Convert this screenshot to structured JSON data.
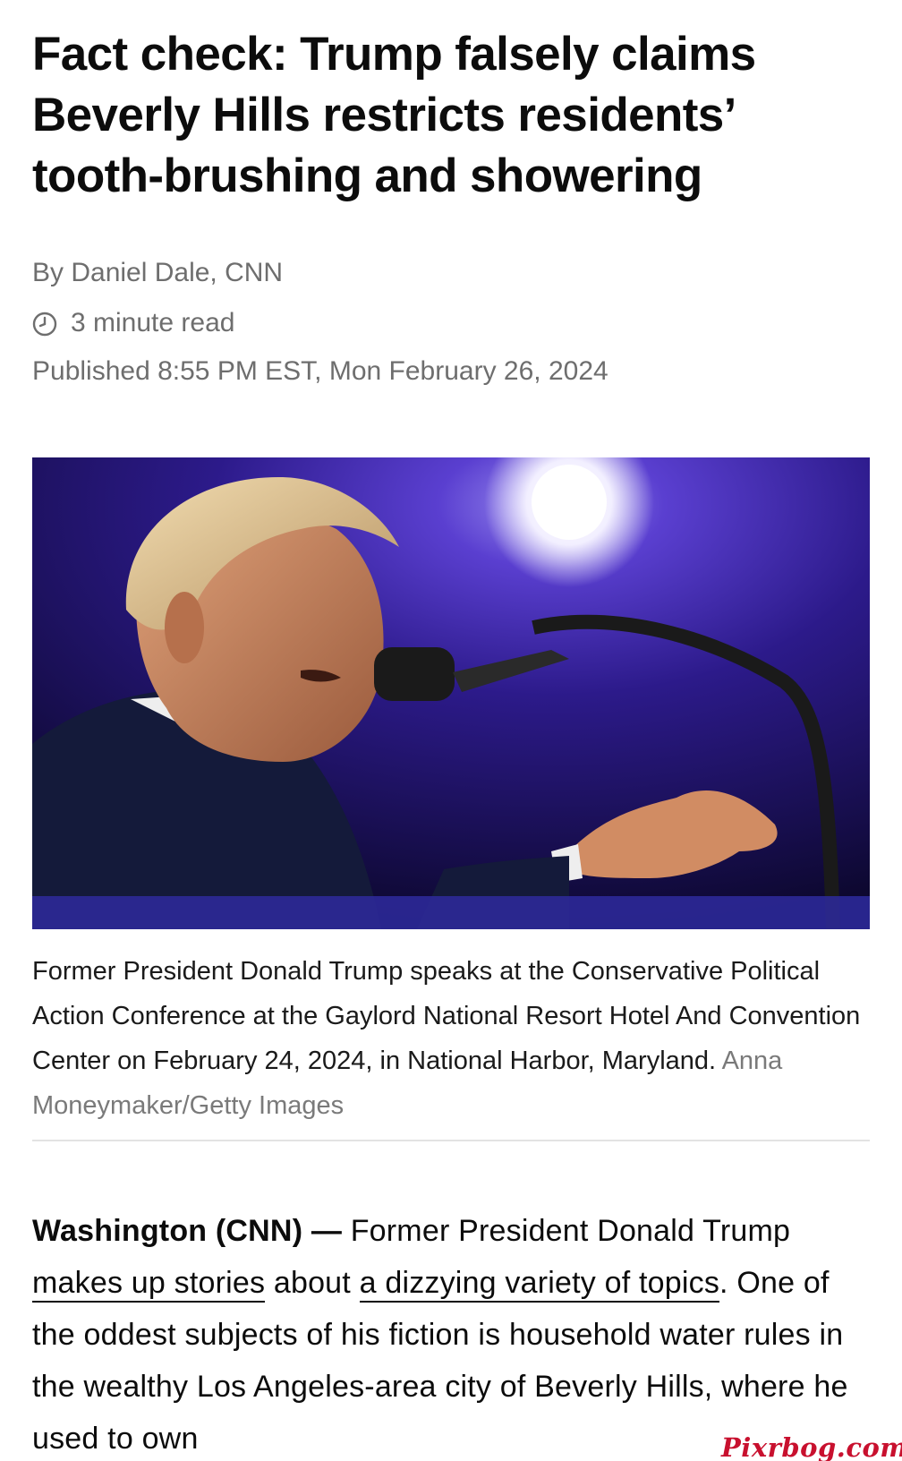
{
  "article": {
    "headline": "Fact check: Trump falsely claims Beverly Hills restricts residents’ tooth-brushing and showering",
    "byline": "By Daniel Dale, CNN",
    "read_time": "3 minute read",
    "published": "Published 8:55 PM EST, Mon February 26, 2024",
    "read_time_icon": "clock-icon"
  },
  "photo": {
    "caption": "Former President Donald Trump speaks at the Conservative Political Action Conference at the Gaylord National Resort Hotel And Convention Center on February 24, 2024, in National Harbor, Maryland.",
    "credit": "Anna Moneymaker/Getty Images"
  },
  "body": {
    "dateline": "Washington (CNN) —",
    "text_1": " Former President Donald Trump ",
    "link_1": "makes up stories",
    "text_2": " about ",
    "link_2": "a dizzying variety of topics",
    "text_3": ". One of the oddest subjects of his fiction is household water rules in the wealthy Los Angeles-area city of Beverly Hills, where he used to own"
  },
  "watermark": "Pixrbog.com"
}
